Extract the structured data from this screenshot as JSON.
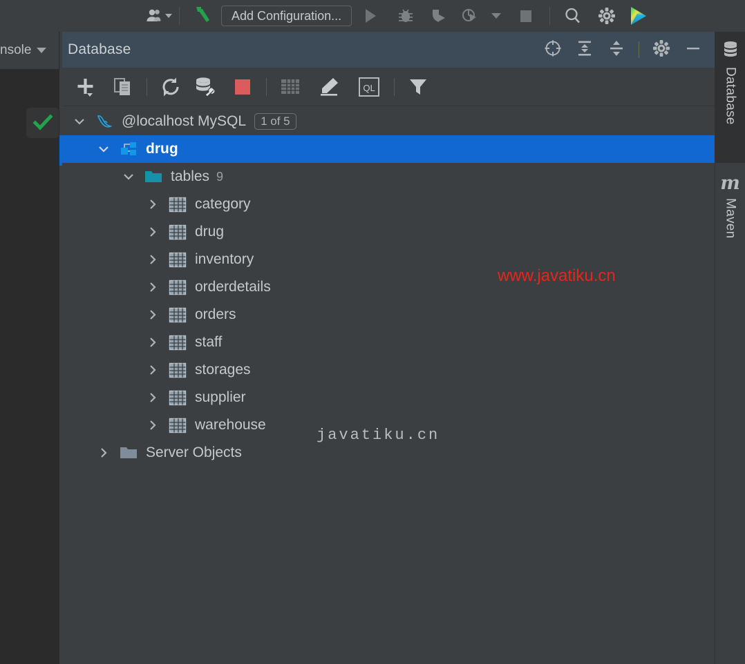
{
  "main_toolbar": {
    "items": [
      {
        "name": "vcs-users-icon",
        "label": "",
        "icon": "users-icon",
        "has_caret": true
      },
      {
        "name": "build-hammer-icon",
        "label": "",
        "icon": "hammer-icon",
        "has_caret": false
      },
      {
        "name": "add-configuration-button",
        "label": "Add Configuration...",
        "icon": "",
        "has_caret": false
      },
      {
        "name": "run-button",
        "label": "",
        "icon": "play-icon",
        "has_caret": false
      },
      {
        "name": "debug-button",
        "label": "",
        "icon": "bug-icon",
        "has_caret": false
      },
      {
        "name": "run-with-coverage-button",
        "label": "",
        "icon": "coverage-run-icon",
        "has_caret": false
      },
      {
        "name": "profile-button",
        "label": "",
        "icon": "profiler-run-icon",
        "has_caret": true
      },
      {
        "name": "stop-button",
        "label": "",
        "icon": "stop-square-icon",
        "has_caret": false
      },
      {
        "name": "search-everywhere-button",
        "label": "",
        "icon": "search-icon",
        "has_caret": false
      },
      {
        "name": "settings-button",
        "label": "",
        "icon": "gear-icon",
        "has_caret": false
      },
      {
        "name": "toolbox-logo",
        "label": "",
        "icon": "intellij-logo-icon",
        "has_caret": false
      }
    ],
    "add_configuration_label": "Add Configuration..."
  },
  "left_panel": {
    "console_tab_label": "nsole",
    "status_check": "✔"
  },
  "database_panel": {
    "title": "Database",
    "header_actions": [
      {
        "name": "scroll-from-source-icon",
        "tooltip": "Scroll from Source"
      },
      {
        "name": "expand-all-icon",
        "tooltip": "Expand All"
      },
      {
        "name": "collapse-all-icon",
        "tooltip": "Collapse All"
      },
      {
        "name": "settings-gear-icon",
        "tooltip": "Settings"
      },
      {
        "name": "minimize-icon",
        "tooltip": "Hide"
      }
    ],
    "toolbar_actions": [
      {
        "name": "add-new-icon",
        "tooltip": "New",
        "caret": true
      },
      {
        "name": "duplicate-icon",
        "tooltip": "Duplicate"
      },
      {
        "name": "refresh-icon",
        "tooltip": "Refresh"
      },
      {
        "name": "data-source-properties-icon",
        "tooltip": "Data Source Properties"
      },
      {
        "name": "stop-red-icon",
        "tooltip": "Stop"
      },
      {
        "name": "open-table-icon",
        "tooltip": "Open Table Editor"
      },
      {
        "name": "edit-data-icon",
        "tooltip": "Modify Object"
      },
      {
        "name": "query-console-icon",
        "tooltip": "Open Query Console",
        "label": "QL"
      },
      {
        "name": "filter-icon",
        "tooltip": "Filter"
      }
    ]
  },
  "tree": {
    "connection": {
      "label": "@localhost MySQL",
      "badge": "1 of 5",
      "icon": "mysql-dolphin-icon",
      "expanded": true
    },
    "schema": {
      "label": "drug",
      "icon": "schema-icon",
      "expanded": true,
      "selected": true
    },
    "tables_folder": {
      "label": "tables",
      "count": "9",
      "icon": "folder-teal-icon",
      "expanded": true
    },
    "tables": [
      {
        "label": "category",
        "icon": "table-icon"
      },
      {
        "label": "drug",
        "icon": "table-icon"
      },
      {
        "label": "inventory",
        "icon": "table-icon"
      },
      {
        "label": "orderdetails",
        "icon": "table-icon"
      },
      {
        "label": "orders",
        "icon": "table-icon"
      },
      {
        "label": "staff",
        "icon": "table-icon"
      },
      {
        "label": "storages",
        "icon": "table-icon"
      },
      {
        "label": "supplier",
        "icon": "table-icon"
      },
      {
        "label": "warehouse",
        "icon": "table-icon"
      }
    ],
    "server_objects": {
      "label": "Server Objects",
      "icon": "folder-gray-icon",
      "expanded": false
    }
  },
  "watermarks": {
    "red": "www.javatiku.cn",
    "gray": "javatiku.cn"
  },
  "right_sidebar": {
    "tabs": [
      {
        "label": "Database",
        "icon": "database-stack-icon",
        "active": true
      },
      {
        "label": "Maven",
        "icon": "maven-m-icon",
        "active": false
      }
    ]
  },
  "colors": {
    "selection_blue": "#1068d0",
    "panel_bg": "#3c3f41",
    "header_bg": "#3c4b57",
    "folder_teal": "#1791a8",
    "watermark_red": "#e8241c",
    "stop_red": "#db5c5c",
    "hammer_green": "#23a24d"
  }
}
